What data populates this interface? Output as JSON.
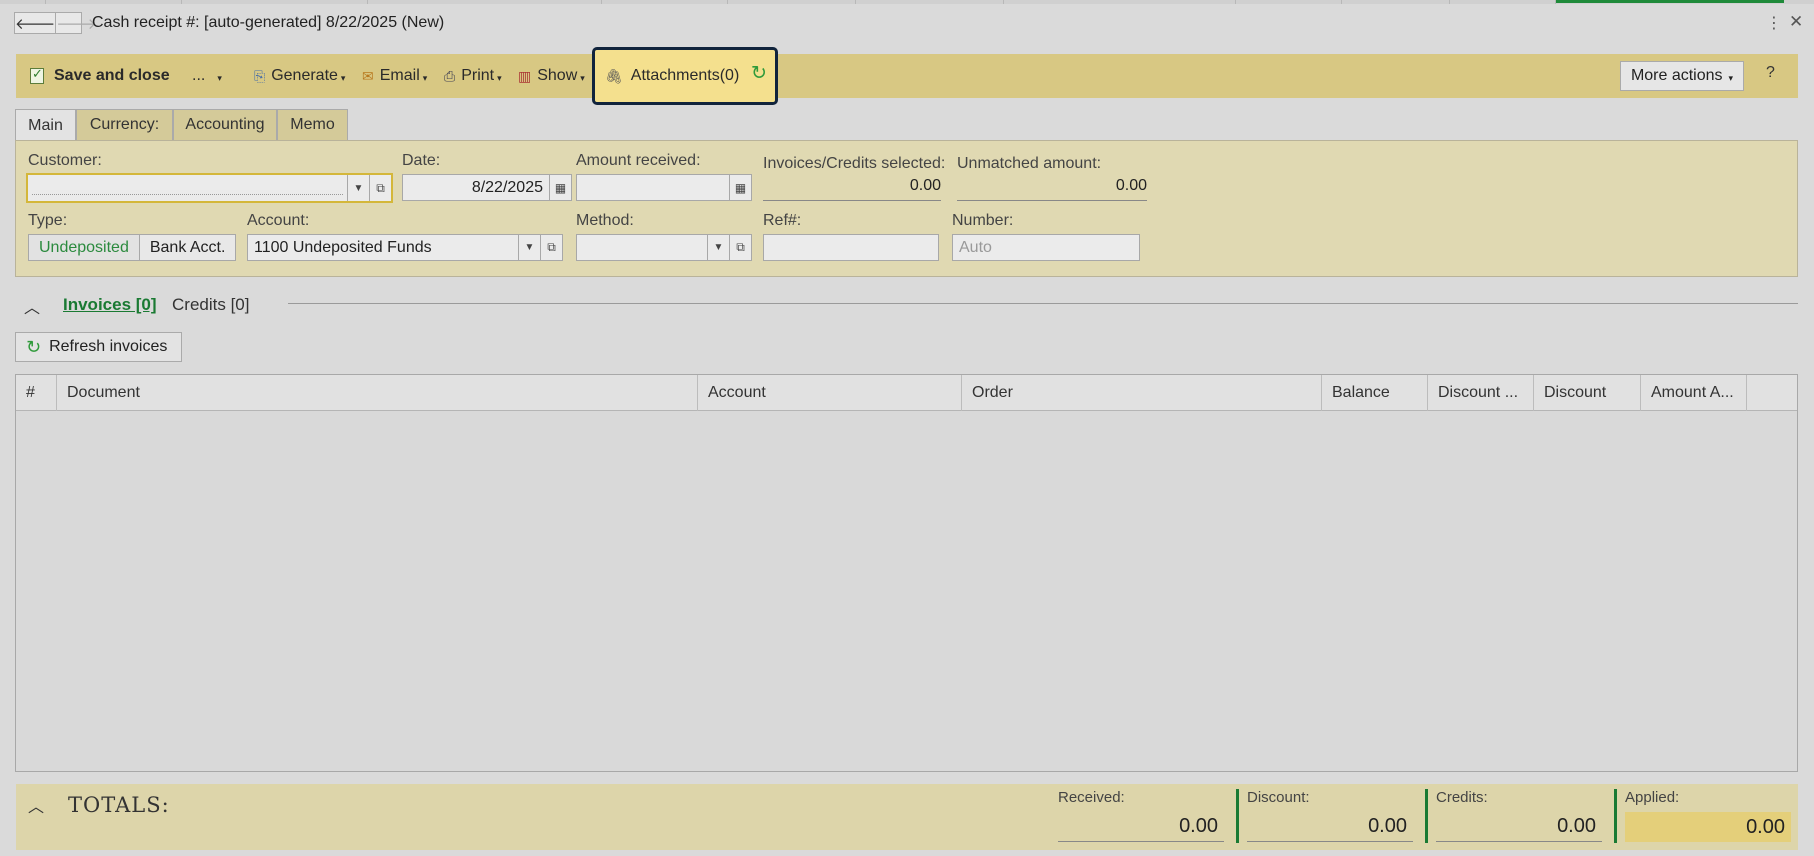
{
  "window": {
    "title": "Cash receipt #: [auto-generated] 8/22/2025 (New)",
    "back_glyph": "🡐",
    "forward_glyph": "🡒",
    "kebab_glyph": "⋮",
    "close_glyph": "✕"
  },
  "toolbar": {
    "save_close": "Save and close",
    "ellipsis": "...",
    "generate": "Generate",
    "email": "Email",
    "print": "Print",
    "show": "Show",
    "attachments": "Attachments(0)",
    "more_actions": "More actions",
    "help": "?",
    "caret": "▾"
  },
  "tabs": [
    {
      "label": "Main",
      "active": true
    },
    {
      "label": "Currency:"
    },
    {
      "label": "Accounting"
    },
    {
      "label": "Memo"
    }
  ],
  "form": {
    "customer": {
      "label": "Customer:",
      "value": ""
    },
    "date": {
      "label": "Date:",
      "value": "8/22/2025"
    },
    "amount_received": {
      "label": "Amount received:",
      "value": ""
    },
    "invoices_credits_selected": {
      "label": "Invoices/Credits selected:",
      "value": "0.00"
    },
    "unmatched_amount": {
      "label": "Unmatched amount:",
      "value": "0.00"
    },
    "type": {
      "label": "Type:",
      "options": [
        "Undeposited",
        "Bank Acct."
      ],
      "selected": "Undeposited"
    },
    "account": {
      "label": "Account:",
      "value": "1100 Undeposited Funds"
    },
    "method": {
      "label": "Method:",
      "value": ""
    },
    "ref": {
      "label": "Ref#:",
      "value": ""
    },
    "number": {
      "label": "Number:",
      "placeholder": "Auto"
    }
  },
  "invoices_section": {
    "invoices_tab": "Invoices [0]",
    "credits_tab": "Credits [0]",
    "refresh_button": "Refresh invoices",
    "columns": [
      "#",
      "Document",
      "Account",
      "Order",
      "Balance",
      "Discount ...",
      "Discount",
      "Amount A..."
    ],
    "rows": []
  },
  "totals": {
    "title": "TOTALS:",
    "received": {
      "label": "Received:",
      "value": "0.00"
    },
    "discount": {
      "label": "Discount:",
      "value": "0.00"
    },
    "credits": {
      "label": "Credits:",
      "value": "0.00"
    },
    "applied": {
      "label": "Applied:",
      "value": "0.00"
    }
  },
  "colors": {
    "toolbar_bg": "#d8c883",
    "form_bg": "#e0d9b2",
    "accent_green": "#1a7a33",
    "highlight_border": "#11243c"
  }
}
